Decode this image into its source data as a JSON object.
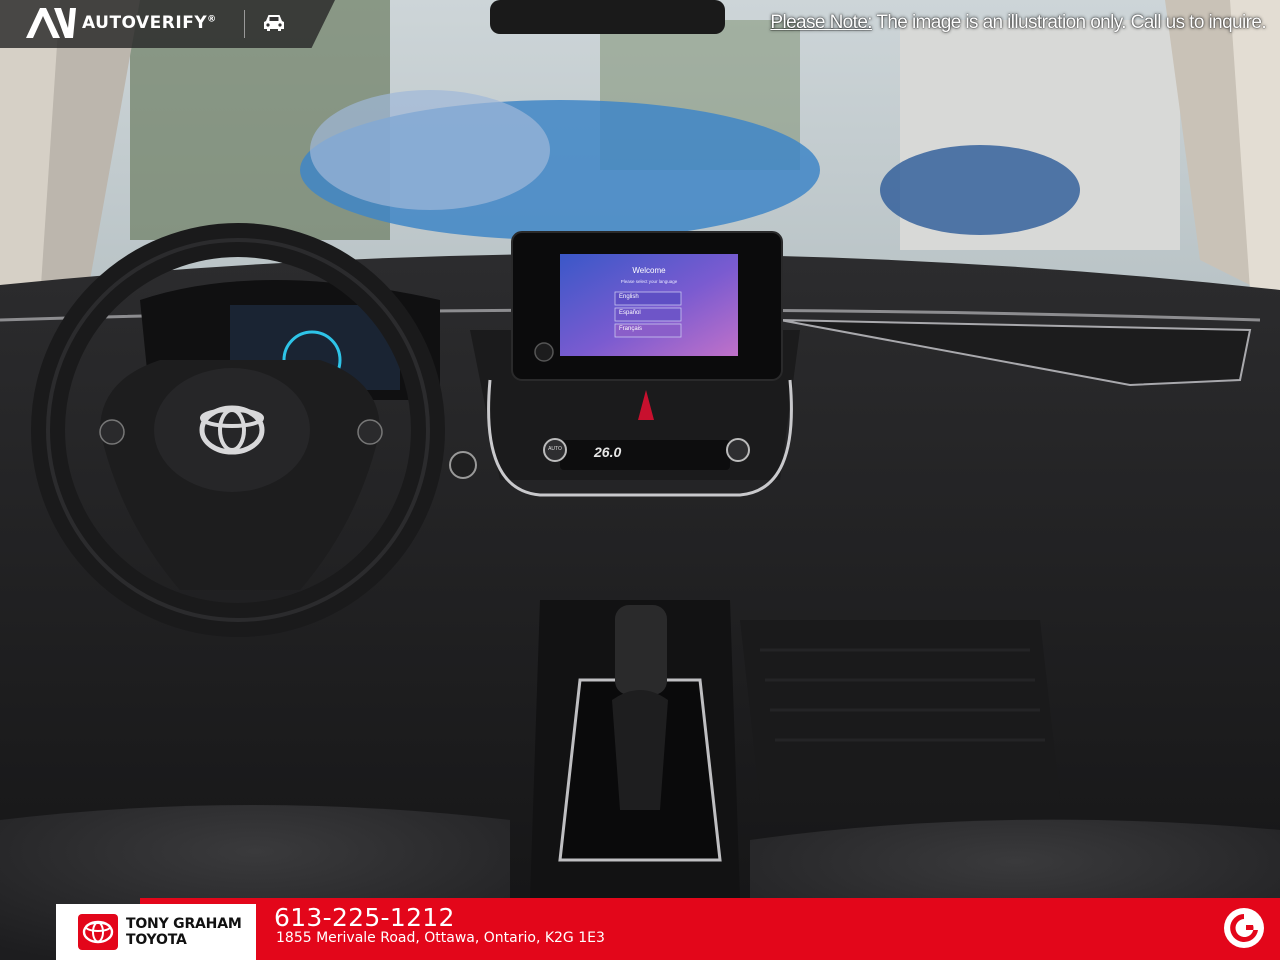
{
  "watermark": {
    "brand": "AUTOVERIFY",
    "brand_mark": "®",
    "logo_icon": "autoverify-logo-icon",
    "car_icon": "car-icon"
  },
  "notice": {
    "label": "Please Note:",
    "text": " The image is an illustration only. Call us to inquire."
  },
  "screen": {
    "title": "Welcome",
    "subtitle": "Please select your language",
    "languages": [
      "English",
      "Español",
      "Français"
    ]
  },
  "climate": {
    "temperature": "26.0",
    "auto_label": "AUTO"
  },
  "dealer": {
    "name_line1": "TONY GRAHAM",
    "name_line2": "TOYOTA",
    "phone": "613-225-1212",
    "address": "1855 Merivale Road, Ottawa, Ontario, K2G 1E3",
    "brand_color": "#e3061a"
  }
}
